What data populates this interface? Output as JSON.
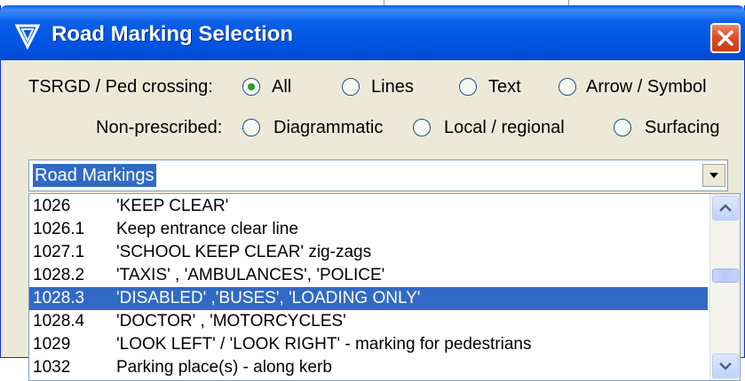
{
  "window": {
    "title": "Road Marking Selection"
  },
  "tsrgd": {
    "label": "TSRGD / Ped crossing:",
    "options": [
      {
        "label": "All",
        "selected": true
      },
      {
        "label": "Lines",
        "selected": false
      },
      {
        "label": "Text",
        "selected": false
      },
      {
        "label": "Arrow / Symbol",
        "selected": false
      }
    ]
  },
  "nonprescribed": {
    "label": "Non-prescribed:",
    "options": [
      {
        "label": "Diagrammatic",
        "selected": false
      },
      {
        "label": "Local / regional",
        "selected": false
      },
      {
        "label": "Surfacing",
        "selected": false
      }
    ]
  },
  "combo": {
    "value": "Road Markings"
  },
  "list": {
    "items": [
      {
        "code": "1026",
        "desc": "'KEEP CLEAR'",
        "selected": false
      },
      {
        "code": "1026.1",
        "desc": "Keep entrance clear line",
        "selected": false
      },
      {
        "code": "1027.1",
        "desc": "'SCHOOL KEEP CLEAR' zig-zags",
        "selected": false
      },
      {
        "code": "1028.2",
        "desc": "'TAXIS' , 'AMBULANCES', 'POLICE'",
        "selected": false
      },
      {
        "code": "1028.3",
        "desc": "'DISABLED' ,'BUSES', 'LOADING ONLY'",
        "selected": true
      },
      {
        "code": "1028.4",
        "desc": "'DOCTOR' , 'MOTORCYCLES'",
        "selected": false
      },
      {
        "code": "1029",
        "desc": "'LOOK LEFT' / 'LOOK RIGHT' - marking for pedestrians",
        "selected": false
      },
      {
        "code": "1032",
        "desc": "Parking place(s) - along kerb",
        "selected": false
      }
    ]
  },
  "icons": {
    "title": "funnel-icon",
    "close": "close-icon",
    "combo_arrow": "chevron-down-icon",
    "scroll_up": "scroll-up-icon",
    "scroll_down": "scroll-down-icon"
  },
  "colors": {
    "titlebar": "#0054e3",
    "selection": "#316ac5",
    "dialog_bg": "#ece9d8",
    "close": "#e24b26"
  }
}
